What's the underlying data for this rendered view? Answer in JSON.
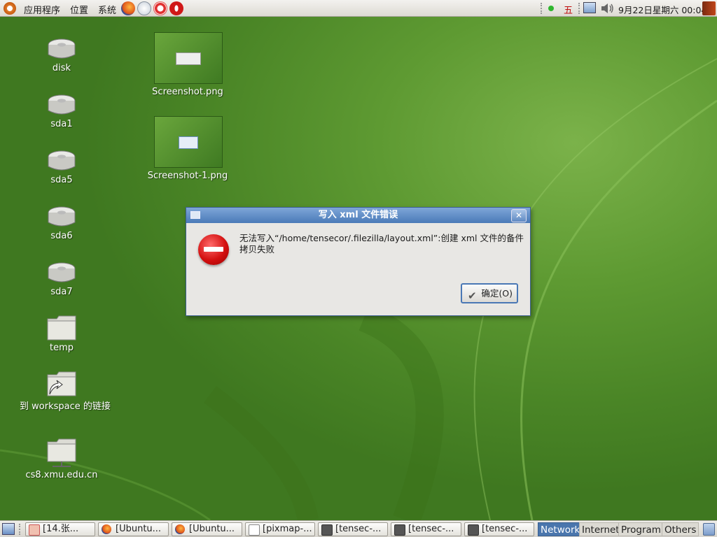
{
  "top_panel": {
    "menus": [
      "应用程序",
      "位置",
      "系统"
    ],
    "launchers": [
      "firefox-icon",
      "mail-icon",
      "help-icon",
      "opera-icon"
    ],
    "input_method": "五",
    "datetime": "9月22日星期六 00:04"
  },
  "desktop_icons": [
    {
      "label": "disk",
      "type": "drive"
    },
    {
      "label": "sda1",
      "type": "drive"
    },
    {
      "label": "sda5",
      "type": "drive"
    },
    {
      "label": "sda6",
      "type": "drive"
    },
    {
      "label": "sda7",
      "type": "drive"
    },
    {
      "label": "temp",
      "type": "folder"
    },
    {
      "label": "到 workspace 的链接",
      "type": "folder-link"
    },
    {
      "label": "cs8.xmu.edu.cn",
      "type": "network-folder"
    },
    {
      "label": "Screenshot.png",
      "type": "image"
    },
    {
      "label": "Screenshot-1.png",
      "type": "image"
    }
  ],
  "dialog": {
    "title": "写入 xml 文件错误",
    "message": "无法写入“/home/tensecor/.filezilla/layout.xml”:创建 xml 文件的备件拷贝失败",
    "ok_label": "确定(O)",
    "close_glyph": "✕"
  },
  "taskbar": {
    "tasks": [
      "[14.张...",
      "[Ubuntu...",
      "[Ubuntu...",
      "[pixmap-...",
      "[tensec-...",
      "[tensec-...",
      "[tensec-..."
    ],
    "workspaces": [
      {
        "label": "Network",
        "active": true
      },
      {
        "label": "Internet",
        "active": false
      },
      {
        "label": "Program",
        "active": false
      },
      {
        "label": "Others",
        "active": false
      }
    ]
  }
}
